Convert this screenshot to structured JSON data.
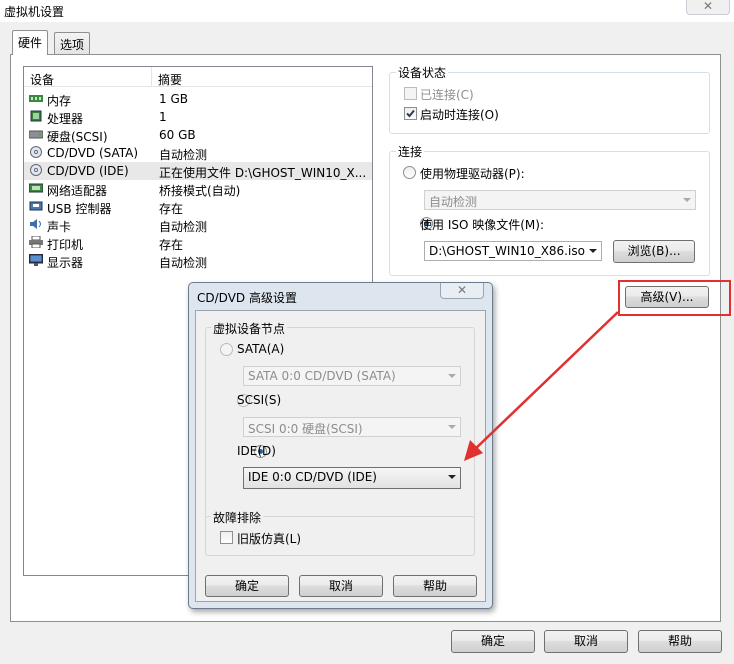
{
  "window": {
    "title": "虚拟机设置",
    "close": "✕"
  },
  "tabs": {
    "hardware": "硬件",
    "options": "选项"
  },
  "device_list": {
    "col_device": "设备",
    "col_summary": "摘要",
    "rows": [
      {
        "name": "内存",
        "summary": "1 GB",
        "icon": "memory-icon"
      },
      {
        "name": "处理器",
        "summary": "1",
        "icon": "cpu-icon"
      },
      {
        "name": "硬盘(SCSI)",
        "summary": "60 GB",
        "icon": "hdd-icon"
      },
      {
        "name": "CD/DVD (SATA)",
        "summary": "自动检测",
        "icon": "cd-icon"
      },
      {
        "name": "CD/DVD (IDE)",
        "summary": "正在使用文件 D:\\GHOST_WIN10_X...",
        "icon": "cd-icon"
      },
      {
        "name": "网络适配器",
        "summary": "桥接模式(自动)",
        "icon": "network-icon"
      },
      {
        "name": "USB 控制器",
        "summary": "存在",
        "icon": "usb-icon"
      },
      {
        "name": "声卡",
        "summary": "自动检测",
        "icon": "sound-icon"
      },
      {
        "name": "打印机",
        "summary": "存在",
        "icon": "printer-icon"
      },
      {
        "name": "显示器",
        "summary": "自动检测",
        "icon": "monitor-icon"
      }
    ]
  },
  "device_status": {
    "title": "设备状态",
    "connected": "已连接(C)",
    "connect_on_start": "启动时连接(O)"
  },
  "connection": {
    "title": "连接",
    "physical": "使用物理驱动器(P):",
    "physical_value": "自动检测",
    "iso": "使用 ISO 映像文件(M):",
    "iso_value": "D:\\GHOST_WIN10_X86.iso",
    "browse": "浏览(B)..."
  },
  "advanced_button": "高级(V)...",
  "dialog": {
    "title": "CD/DVD 高级设置",
    "close": "✕",
    "node_group": "虚拟设备节点",
    "sata": "SATA(A)",
    "sata_value": "SATA 0:0   CD/DVD (SATA)",
    "scsi": "SCSI(S)",
    "scsi_value": "SCSI 0:0   硬盘(SCSI)",
    "ide": "IDE(D)",
    "ide_value": "IDE 0:0   CD/DVD (IDE)",
    "troubleshoot_group": "故障排除",
    "legacy": "旧版仿真(L)",
    "ok": "确定",
    "cancel": "取消",
    "help": "帮助"
  },
  "footer": {
    "ok": "确定",
    "cancel": "取消",
    "help": "帮助"
  },
  "colors": {
    "highlight_box": "#e03030",
    "arrow": "#e03030"
  }
}
